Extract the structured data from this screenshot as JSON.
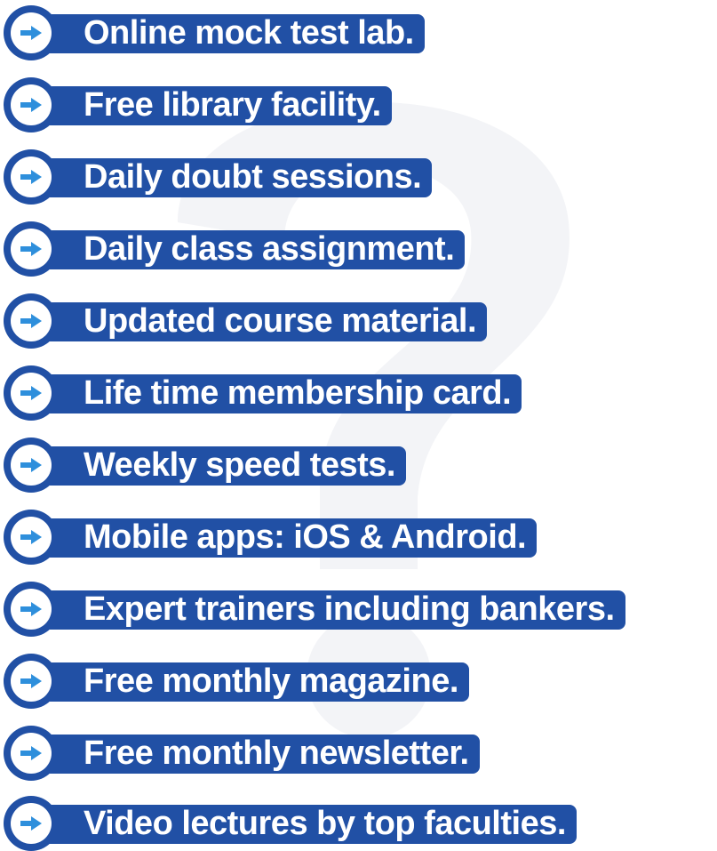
{
  "colors": {
    "brand": "#2150a5",
    "arrow": "#2e8fdc",
    "text": "#ffffff",
    "watermark": "#f3f4f7"
  },
  "icon": "arrow-right-icon",
  "features": [
    "Online mock test lab.",
    "Free library facility.",
    "Daily doubt sessions.",
    "Daily class assignment.",
    "Updated course material.",
    "Life time membership card.",
    "Weekly speed tests.",
    "Mobile apps: iOS & Android.",
    "Expert trainers including bankers.",
    "Free monthly magazine.",
    "Free monthly newsletter.",
    "Video lectures by top faculties."
  ]
}
